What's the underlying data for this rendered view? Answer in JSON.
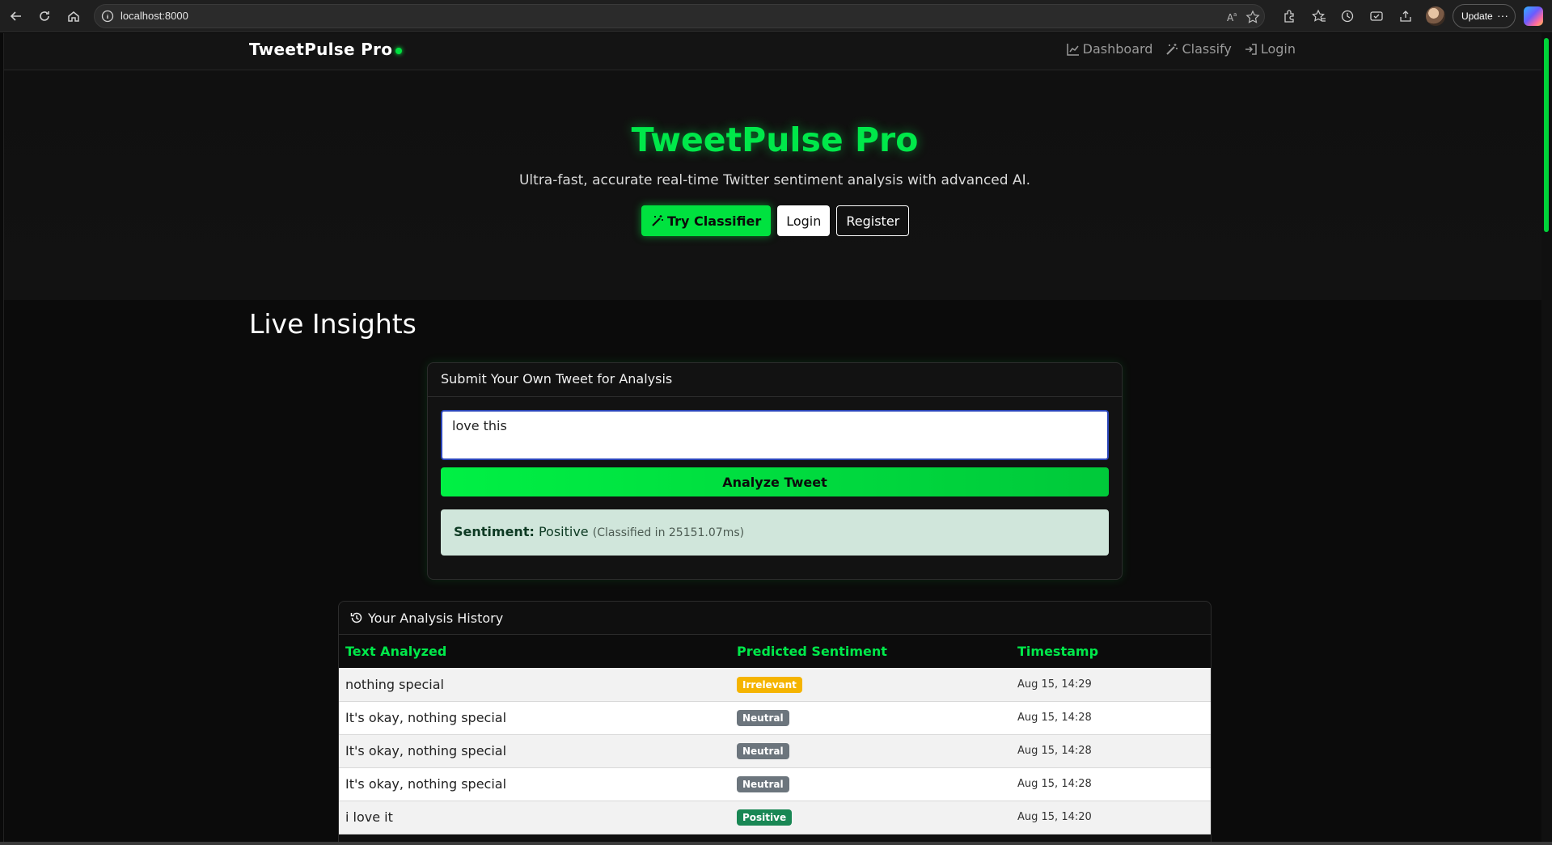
{
  "browser": {
    "url": "localhost:8000",
    "update_label": "Update",
    "more_label": "···"
  },
  "nav": {
    "brand": "TweetPulse Pro",
    "links": [
      {
        "label": "Dashboard",
        "icon": "chart-line-icon"
      },
      {
        "label": "Classify",
        "icon": "magic-wand-icon"
      },
      {
        "label": "Login",
        "icon": "sign-in-icon"
      }
    ]
  },
  "hero": {
    "title": "TweetPulse Pro",
    "subtitle": "Ultra-fast, accurate real-time Twitter sentiment analysis with advanced AI.",
    "try_label": "Try Classifier",
    "login_label": "Login",
    "register_label": "Register"
  },
  "insights": {
    "title": "Live Insights",
    "card_title": "Submit Your Own Tweet for Analysis",
    "input_value": "love this",
    "analyze_label": "Analyze Tweet",
    "result_label": "Sentiment:",
    "result_value": "Positive",
    "result_time": "(Classified in 25151.07ms)"
  },
  "history": {
    "title": "Your Analysis History",
    "columns": [
      "Text Analyzed",
      "Predicted Sentiment",
      "Timestamp"
    ],
    "rows": [
      {
        "text": "nothing special",
        "sentiment": "Irrelevant",
        "timestamp": "Aug 15, 14:29"
      },
      {
        "text": "It's okay, nothing special",
        "sentiment": "Neutral",
        "timestamp": "Aug 15, 14:28"
      },
      {
        "text": "It's okay, nothing special",
        "sentiment": "Neutral",
        "timestamp": "Aug 15, 14:28"
      },
      {
        "text": "It's okay, nothing special",
        "sentiment": "Neutral",
        "timestamp": "Aug 15, 14:28"
      },
      {
        "text": "i love it",
        "sentiment": "Positive",
        "timestamp": "Aug 15, 14:20"
      }
    ]
  },
  "colors": {
    "accent": "#00e84a",
    "irrelevant": "#f5b400",
    "neutral": "#6c757d",
    "positive": "#198754",
    "result_bg": "#d0e6db"
  }
}
